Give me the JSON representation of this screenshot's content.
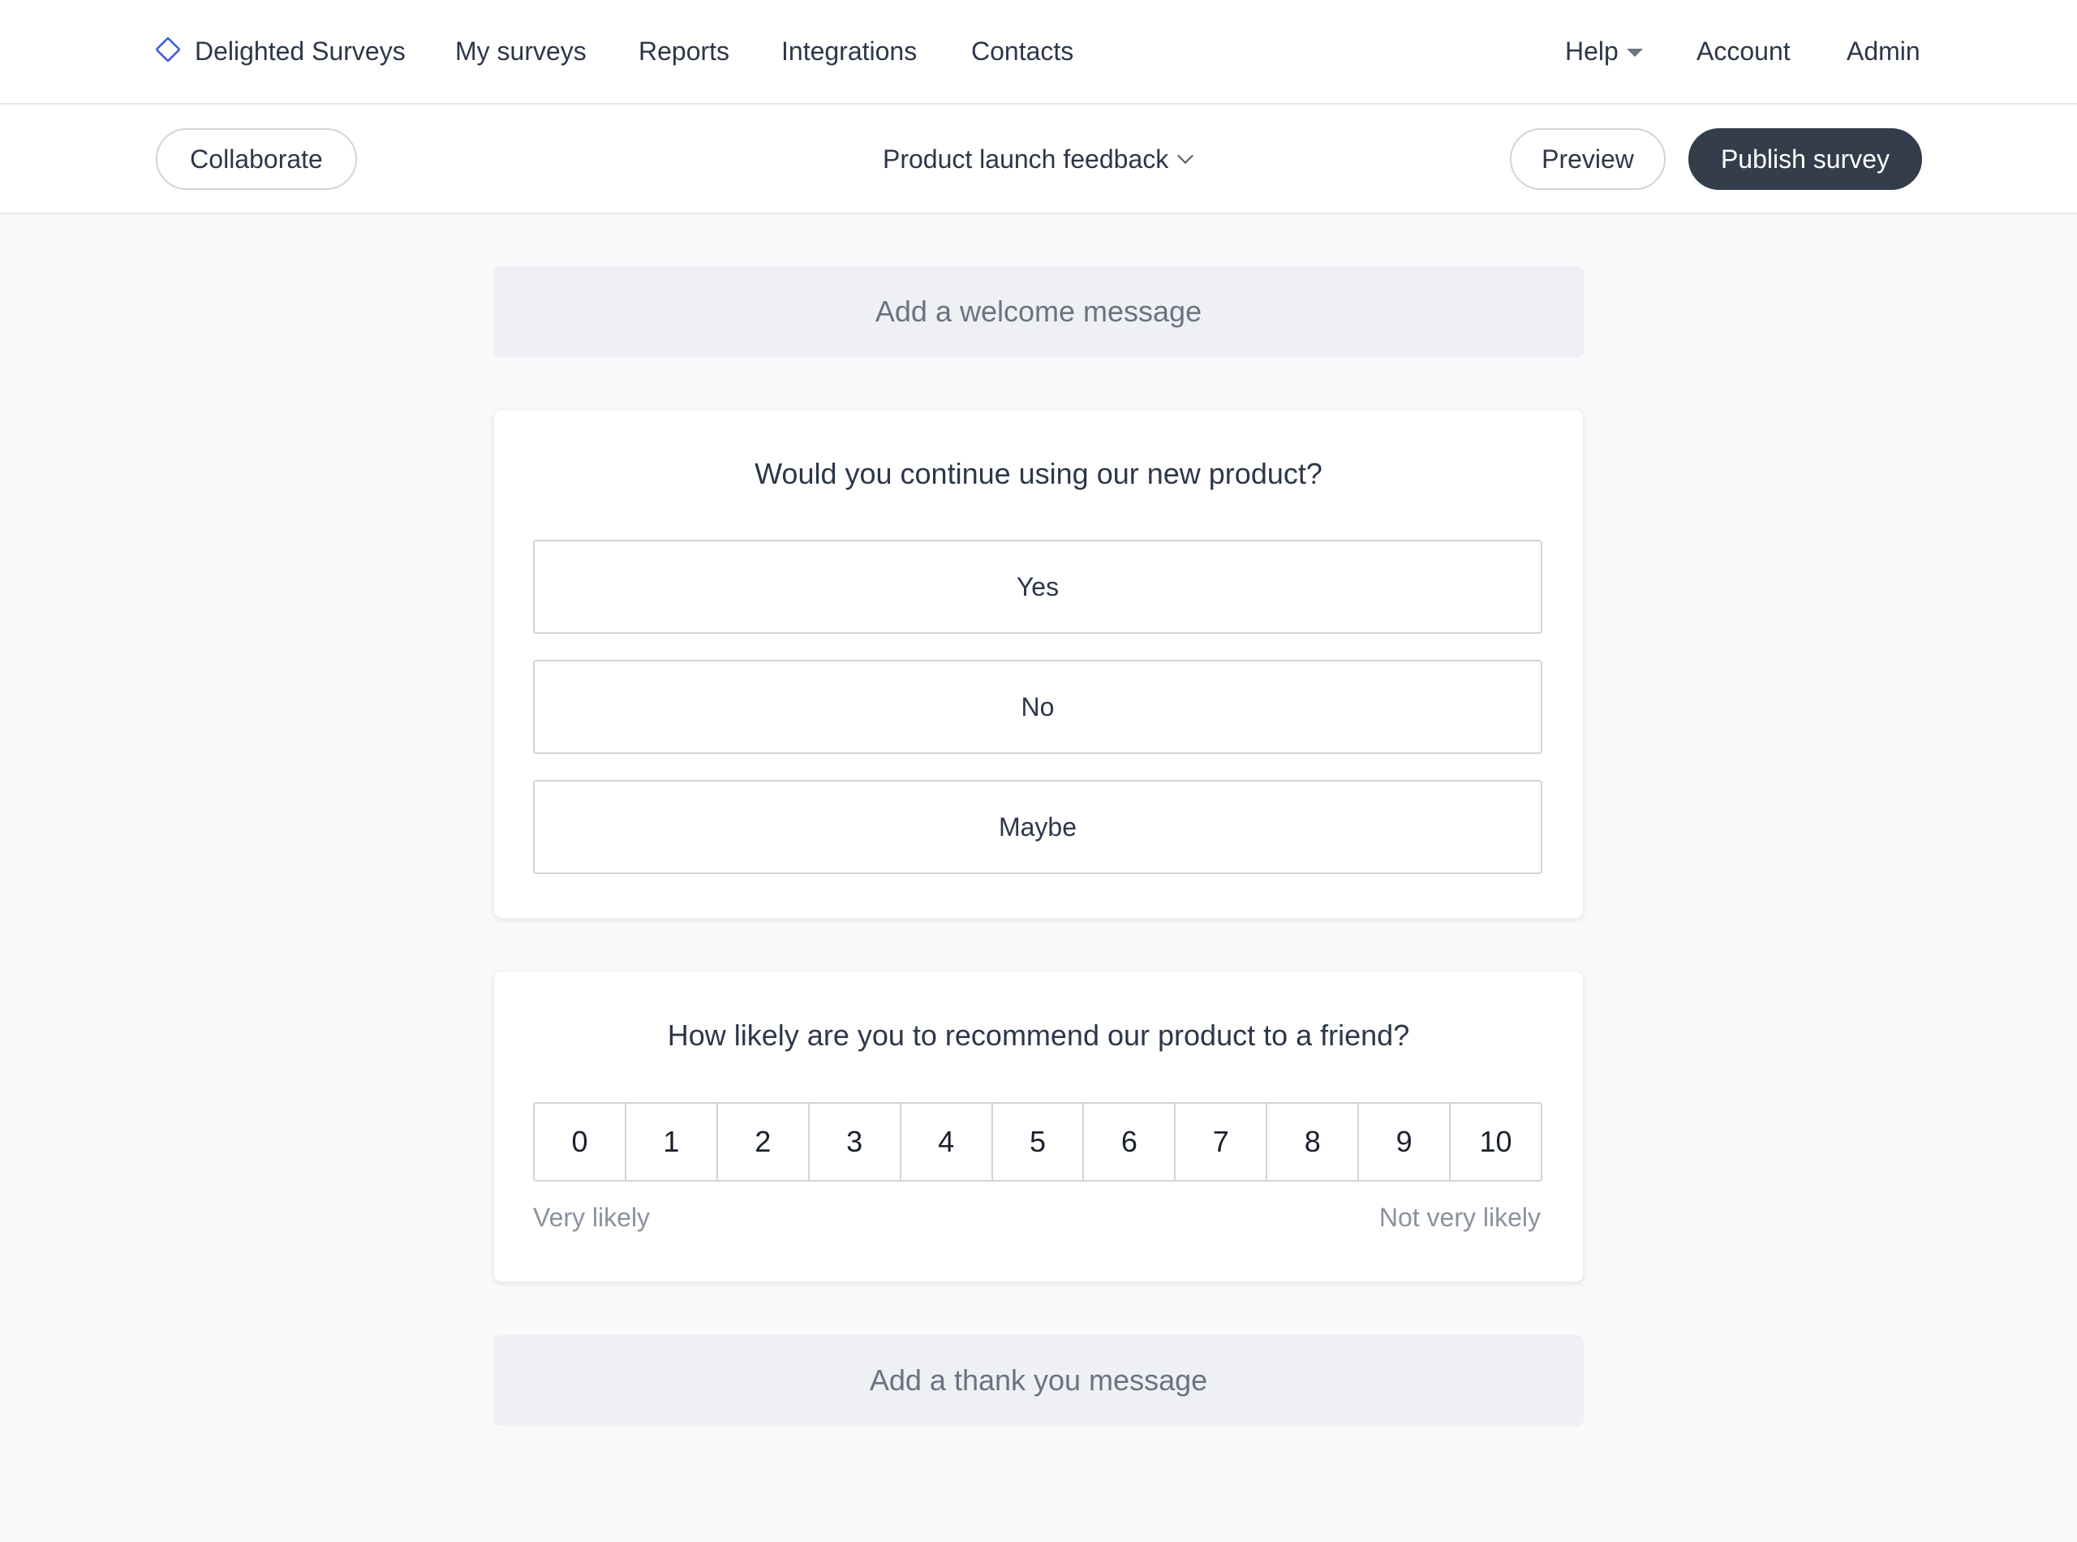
{
  "nav": {
    "brand": "Delighted Surveys",
    "links": [
      "My surveys",
      "Reports",
      "Integrations",
      "Contacts"
    ],
    "right": {
      "help": "Help",
      "account": "Account",
      "admin": "Admin"
    },
    "brand_icon": "diamond-icon",
    "brand_color": "#3b5bdb"
  },
  "toolbar": {
    "collaborate": "Collaborate",
    "survey_name": "Product launch feedback",
    "preview": "Preview",
    "publish": "Publish survey"
  },
  "welcome": {
    "label": "Add a welcome message"
  },
  "question1": {
    "title": "Would you continue using our new product?",
    "options": [
      "Yes",
      "No",
      "Maybe"
    ]
  },
  "question2": {
    "title": "How likely are you to recommend our product to a friend?",
    "scale": [
      "0",
      "1",
      "2",
      "3",
      "4",
      "5",
      "6",
      "7",
      "8",
      "9",
      "10"
    ],
    "low_label": "Very likely",
    "high_label": "Not very likely"
  },
  "thanks": {
    "label": "Add a thank you message"
  },
  "colors": {
    "primary_dark": "#333d4b",
    "border": "#cfd4da",
    "background": "#f8f9fa"
  }
}
